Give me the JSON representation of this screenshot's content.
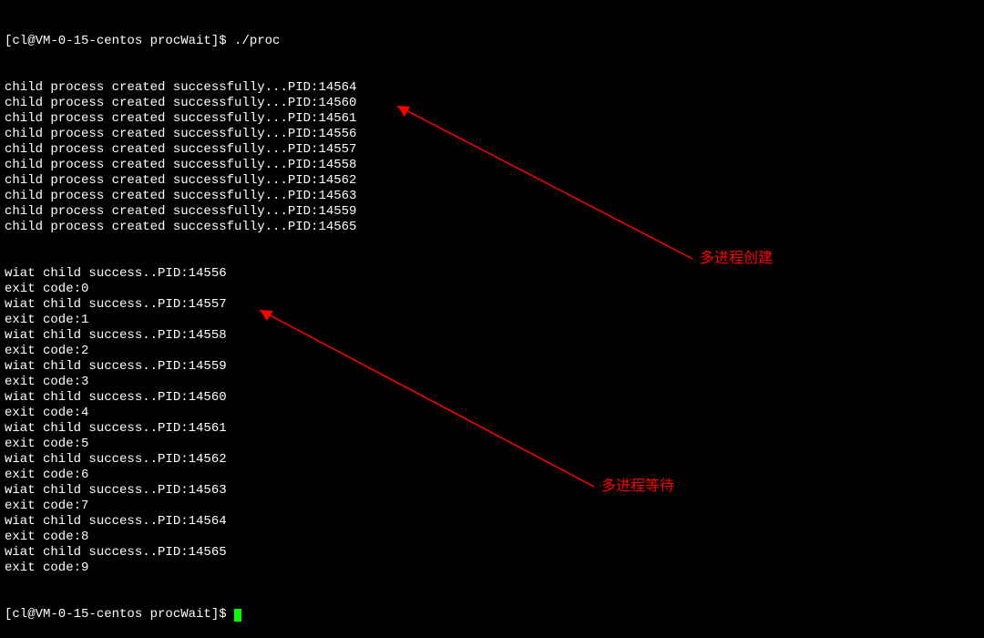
{
  "prompt": {
    "user_host": "[cl@VM-0-15-centos procWait]$",
    "command": "./proc"
  },
  "created": [
    {
      "pid": "14564"
    },
    {
      "pid": "14560"
    },
    {
      "pid": "14561"
    },
    {
      "pid": "14556"
    },
    {
      "pid": "14557"
    },
    {
      "pid": "14558"
    },
    {
      "pid": "14562"
    },
    {
      "pid": "14563"
    },
    {
      "pid": "14559"
    },
    {
      "pid": "14565"
    }
  ],
  "created_prefix": "child process created successfully...PID:",
  "wait_prefix": "wiat child success..PID:",
  "exit_prefix": "exit code:",
  "waits": [
    {
      "pid": "14556",
      "code": "0"
    },
    {
      "pid": "14557",
      "code": "1"
    },
    {
      "pid": "14558",
      "code": "2"
    },
    {
      "pid": "14559",
      "code": "3"
    },
    {
      "pid": "14560",
      "code": "4"
    },
    {
      "pid": "14561",
      "code": "5"
    },
    {
      "pid": "14562",
      "code": "6"
    },
    {
      "pid": "14563",
      "code": "7"
    },
    {
      "pid": "14564",
      "code": "8"
    },
    {
      "pid": "14565",
      "code": "9"
    }
  ],
  "prompt_end": "[cl@VM-0-15-centos procWait]$",
  "annotations": {
    "create": "多进程创建",
    "wait": "多进程等待"
  }
}
